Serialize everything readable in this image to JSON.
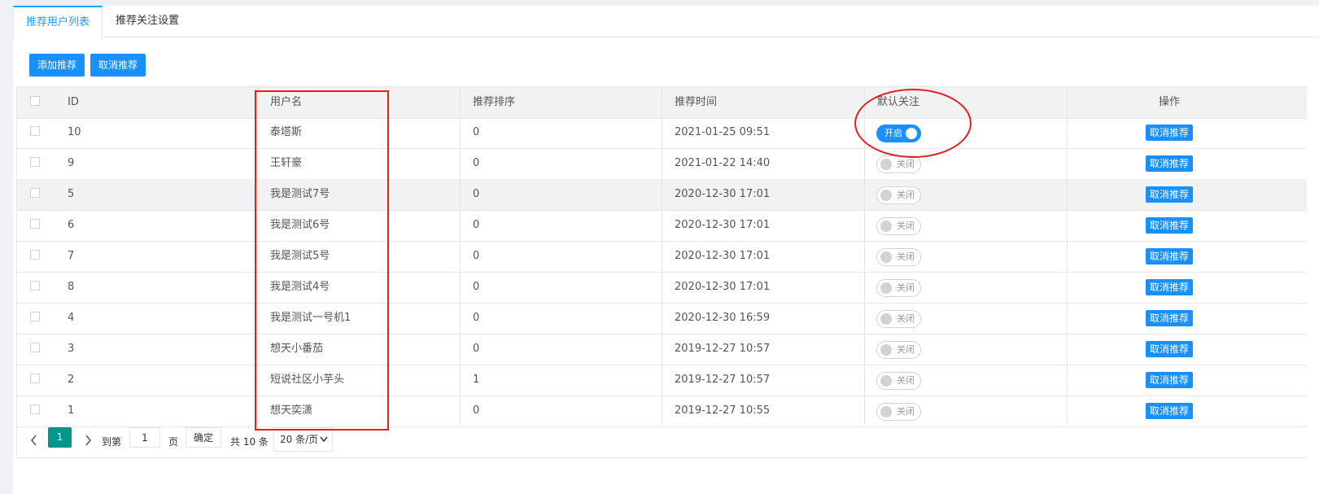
{
  "tabs": [
    {
      "label": "推荐用户列表",
      "active": true
    },
    {
      "label": "推荐关注设置",
      "active": false
    }
  ],
  "toolbar": {
    "add_label": "添加推荐",
    "cancel_label": "取消推荐"
  },
  "table": {
    "headers": {
      "id": "ID",
      "username": "用户名",
      "order": "推荐排序",
      "time": "推荐时间",
      "follow": "默认关注",
      "action": "操作"
    },
    "rows": [
      {
        "id": "10",
        "username": "泰塔斯",
        "order": "0",
        "time": "2021-01-25 09:51",
        "follow": "开启",
        "follow_on": true,
        "action": "取消推荐"
      },
      {
        "id": "9",
        "username": "王轩豪",
        "order": "0",
        "time": "2021-01-22 14:40",
        "follow": "关闭",
        "follow_on": false,
        "action": "取消推荐"
      },
      {
        "id": "5",
        "username": "我是测试7号",
        "order": "0",
        "time": "2020-12-30 17:01",
        "follow": "关闭",
        "follow_on": false,
        "action": "取消推荐"
      },
      {
        "id": "6",
        "username": "我是测试6号",
        "order": "0",
        "time": "2020-12-30 17:01",
        "follow": "关闭",
        "follow_on": false,
        "action": "取消推荐"
      },
      {
        "id": "7",
        "username": "我是测试5号",
        "order": "0",
        "time": "2020-12-30 17:01",
        "follow": "关闭",
        "follow_on": false,
        "action": "取消推荐"
      },
      {
        "id": "8",
        "username": "我是测试4号",
        "order": "0",
        "time": "2020-12-30 17:01",
        "follow": "关闭",
        "follow_on": false,
        "action": "取消推荐"
      },
      {
        "id": "4",
        "username": "我是测试一号机1",
        "order": "0",
        "time": "2020-12-30 16:59",
        "follow": "关闭",
        "follow_on": false,
        "action": "取消推荐"
      },
      {
        "id": "3",
        "username": "想天小番茄",
        "order": "0",
        "time": "2019-12-27 10:57",
        "follow": "关闭",
        "follow_on": false,
        "action": "取消推荐"
      },
      {
        "id": "2",
        "username": "短说社区小芋头",
        "order": "1",
        "time": "2019-12-27 10:57",
        "follow": "关闭",
        "follow_on": false,
        "action": "取消推荐"
      },
      {
        "id": "1",
        "username": "想天奕潇",
        "order": "0",
        "time": "2019-12-27 10:55",
        "follow": "关闭",
        "follow_on": false,
        "action": "取消推荐"
      }
    ]
  },
  "pagination": {
    "prev_icon": "chevron-left-icon",
    "current_page": "1",
    "next_icon": "chevron-right-icon",
    "goto_label": "到第",
    "goto_value": "1",
    "page_unit": "页",
    "confirm_label": "确定",
    "total_label": "共 10 条",
    "page_size": "20 条/页"
  },
  "colors": {
    "accent": "#1890ff",
    "pager_active": "#009688",
    "annotation": "#e02020"
  }
}
